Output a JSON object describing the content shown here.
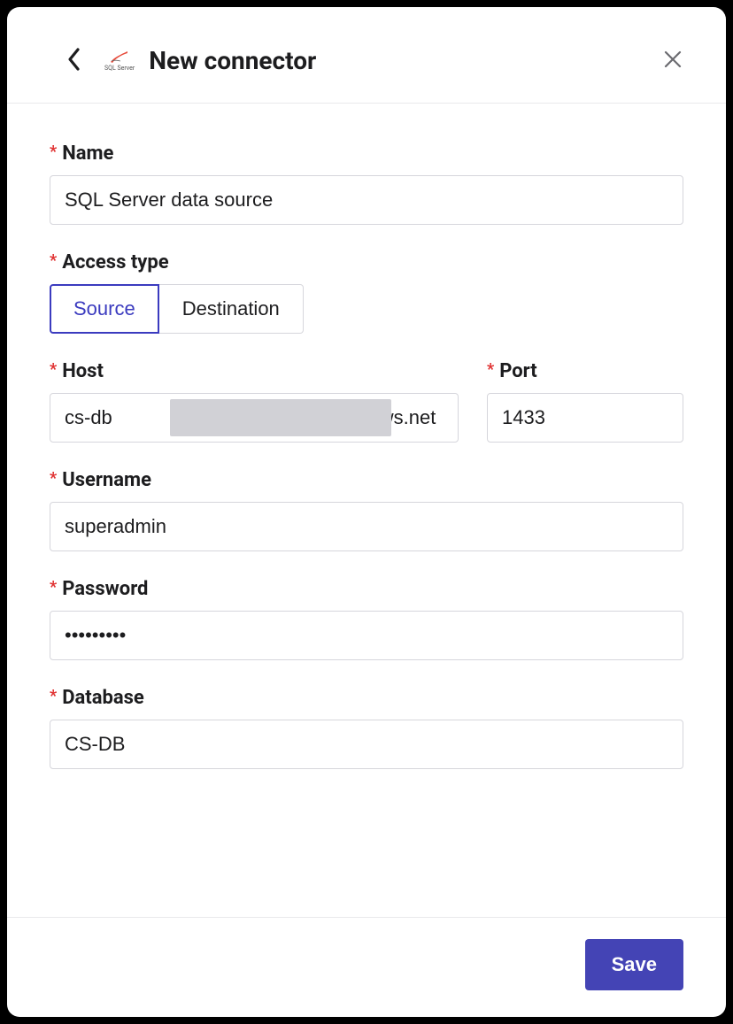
{
  "header": {
    "logo_text": "SQL Server",
    "title": "New connector"
  },
  "form": {
    "labels": {
      "name": "Name",
      "access_type": "Access type",
      "host": "Host",
      "port": "Port",
      "username": "Username",
      "password": "Password",
      "database": "Database"
    },
    "values": {
      "name": "SQL Server data source",
      "host": "cs-db                                       .windows.net",
      "port": "1433",
      "username": "superadmin",
      "password": "•••••••••",
      "database": "CS-DB"
    },
    "access_type": {
      "options": [
        "Source",
        "Destination"
      ],
      "selected": "Source"
    }
  },
  "footer": {
    "save_label": "Save"
  },
  "colors": {
    "accent": "#4444b5",
    "required": "#e03131",
    "border": "#d6d6dc"
  }
}
